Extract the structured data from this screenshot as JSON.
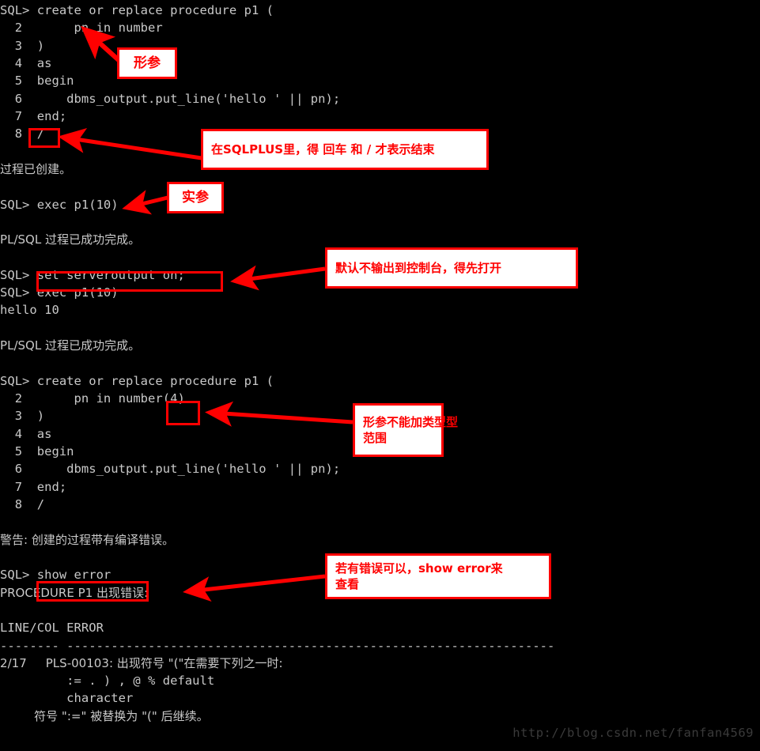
{
  "terminal": {
    "background_color": "#000000",
    "text_color": "#c9c9c9",
    "lines": [
      "SQL> create or replace procedure p1 (",
      "  2       pn in number",
      "  3  )",
      "  4  as",
      "  5  begin",
      "  6      dbms_output.put_line('hello ' || pn);",
      "  7  end;",
      "  8  /",
      "",
      "过程已创建。",
      "",
      "SQL> exec p1(10)",
      "",
      "PL/SQL 过程已成功完成。",
      "",
      "SQL> set serveroutput on;",
      "SQL> exec p1(10)",
      "hello 10",
      "",
      "PL/SQL 过程已成功完成。",
      "",
      "SQL> create or replace procedure p1 (",
      "  2       pn in number(4)",
      "  3  )",
      "  4  as",
      "  5  begin",
      "  6      dbms_output.put_line('hello ' || pn);",
      "  7  end;",
      "  8  /",
      "",
      "警告: 创建的过程带有编译错误。",
      "",
      "SQL> show error",
      "PROCEDURE P1 出现错误:",
      "",
      "LINE/COL ERROR",
      "-------- ------------------------------------------------------------------",
      "2/17     PLS-00103: 出现符号 \"(\"在需要下列之一时:",
      "         := . ) , @ % default",
      "         character",
      "         符号 \":=\" 被替换为 \"(\" 后继续。"
    ]
  },
  "annotations": {
    "accent_color": "#ff0000",
    "note_bg": "#ffffff",
    "notes": [
      {
        "id": "xingcan",
        "lines": [
          "形参"
        ]
      },
      {
        "id": "sqlplus-enter",
        "lines": [
          "在SQLPLUS里，得 回车 和 / 才表示结束"
        ]
      },
      {
        "id": "shican",
        "lines": [
          "实参"
        ]
      },
      {
        "id": "serveroutput",
        "lines": [
          "默认不输出到控制台，得先打开"
        ]
      },
      {
        "id": "no-type-range",
        "lines": [
          "形参不能加类型型",
          "范围"
        ]
      },
      {
        "id": "show-error-hint",
        "lines": [
          "若有错误可以，show error来",
          "查看"
        ]
      }
    ],
    "highlights": [
      {
        "id": "slash-box",
        "target": "/"
      },
      {
        "id": "serveroutput-box",
        "target": "set serveroutput on;"
      },
      {
        "id": "number4-box",
        "target": "(4)"
      },
      {
        "id": "show-error-box",
        "target": "show error"
      }
    ]
  },
  "watermark": {
    "text": "http://blog.csdn.net/fanfan4569"
  }
}
